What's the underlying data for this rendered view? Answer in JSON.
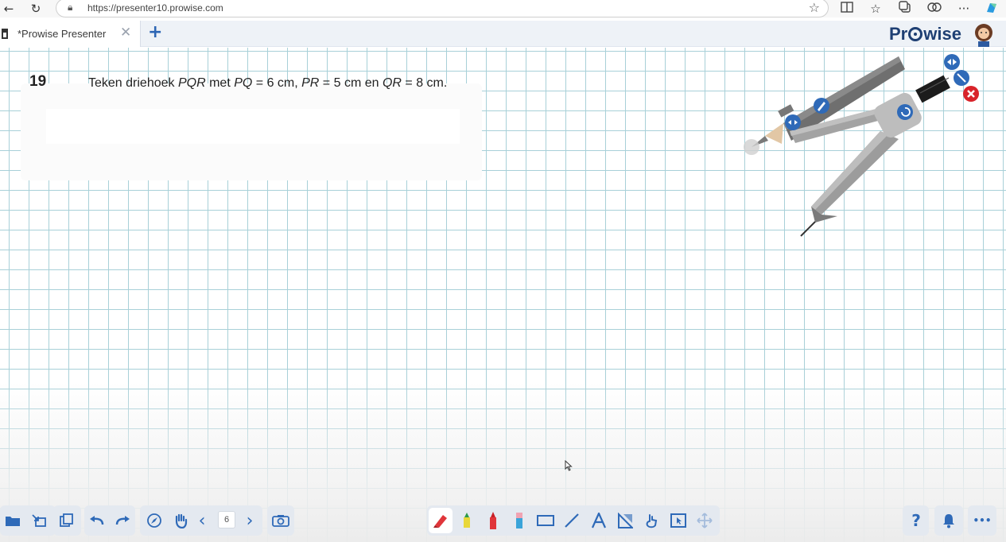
{
  "browser": {
    "url": "https://presenter10.prowise.com"
  },
  "app": {
    "tab_title": "*Prowise Presenter",
    "tab_close": "✕",
    "tab_add": "+",
    "logo_text_a": "Pr",
    "logo_text_b": "wise"
  },
  "question": {
    "number": "19",
    "text_parts": [
      "Teken driehoek ",
      "PQR",
      " met ",
      "PQ",
      " = 6 cm, ",
      "PR",
      " = 5 cm en ",
      "QR",
      " = 8 cm."
    ]
  },
  "toolbar": {
    "page_number": "6",
    "prev": "‹",
    "next": "›",
    "help": "?",
    "more": "•••"
  },
  "colors": {
    "accent": "#2f6ab8",
    "grid": "#a8d0d8",
    "logo": "#1e3f73",
    "close_red": "#d8232a"
  },
  "icons": {
    "browser": [
      "back-arrow-icon",
      "reload-icon",
      "lock-icon",
      "star-icon",
      "split-view-icon",
      "favorites-icon",
      "collections-icon",
      "extensions-icon",
      "more-icon",
      "copilot-icon"
    ],
    "compass_handles": [
      "mirror-icon",
      "resize-icon",
      "close-icon",
      "rotate-icon",
      "pencil-icon",
      "move-icon"
    ]
  }
}
